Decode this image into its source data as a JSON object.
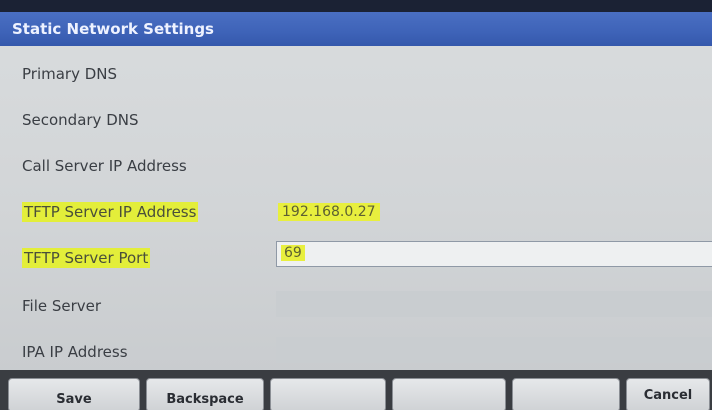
{
  "window": {
    "title": "Static Network Settings"
  },
  "fields": [
    {
      "label": "Primary DNS",
      "value": ""
    },
    {
      "label": "Secondary DNS",
      "value": ""
    },
    {
      "label": "Call Server IP Address",
      "value": ""
    },
    {
      "label": "TFTP Server IP Address",
      "value": "192.168.0.27"
    },
    {
      "label": "TFTP Server Port",
      "value": "69"
    },
    {
      "label": "File Server",
      "value": ""
    },
    {
      "label": "IPA IP Address",
      "value": ""
    }
  ],
  "softkeys": [
    "Save",
    "Backspace",
    "",
    "",
    "",
    "Cancel"
  ],
  "colors": {
    "titlebar": "#3e63b8",
    "highlight": "#e3ee3a"
  }
}
